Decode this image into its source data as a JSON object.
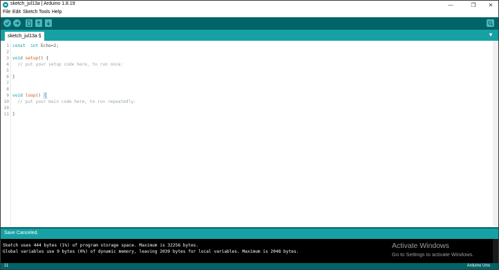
{
  "window": {
    "title": "sketch_jul13a | Arduino 1.8.19",
    "minimize": "—",
    "maximize": "❐",
    "close": "✕"
  },
  "menu": [
    "File",
    "Edit",
    "Sketch",
    "Tools",
    "Help"
  ],
  "toolbar": {
    "verify_icon": "check-icon",
    "upload_icon": "arrow-right-icon",
    "new_icon": "new-file-icon",
    "open_icon": "arrow-up-icon",
    "save_icon": "arrow-down-icon",
    "serial_icon": "magnifier-icon",
    "accent": "#006468"
  },
  "tabs": [
    {
      "label": "sketch_jul13a §"
    }
  ],
  "editor": {
    "lines": [
      {
        "n": "1",
        "parts": [
          [
            "kw",
            "const"
          ],
          [
            "",
            "  "
          ],
          [
            "kw",
            "int"
          ],
          [
            "",
            " Echo=2;"
          ]
        ]
      },
      {
        "n": "2",
        "parts": []
      },
      {
        "n": "3",
        "parts": [
          [
            "kw",
            "void"
          ],
          [
            "",
            " "
          ],
          [
            "fn",
            "setup"
          ],
          [
            "",
            "() {"
          ]
        ]
      },
      {
        "n": "4",
        "parts": [
          [
            "cm",
            "  // put your setup code here, to run once:"
          ]
        ]
      },
      {
        "n": "5",
        "parts": []
      },
      {
        "n": "6",
        "parts": [
          [
            "",
            "}"
          ]
        ]
      },
      {
        "n": "7",
        "parts": []
      },
      {
        "n": "8",
        "parts": []
      },
      {
        "n": "9",
        "parts": [
          [
            "kw",
            "void"
          ],
          [
            "",
            " "
          ],
          [
            "fn",
            "loop"
          ],
          [
            "",
            "() "
          ],
          [
            "brace",
            "{"
          ]
        ]
      },
      {
        "n": "10",
        "parts": [
          [
            "cm",
            "  // put your main code here, to run repeatedly:"
          ]
        ]
      },
      {
        "n": "10",
        "parts": []
      },
      {
        "n": "11",
        "parts": [
          [
            "",
            "}"
          ]
        ]
      }
    ]
  },
  "status": {
    "message": "Save Canceled."
  },
  "console": {
    "line1": "Sketch uses 444 bytes (1%) of program storage space. Maximum is 32256 bytes.",
    "line2": "Global variables use 9 bytes (0%) of dynamic memory, leaving 2039 bytes for local variables. Maximum is 2048 bytes.",
    "watermark_title": "Activate Windows",
    "watermark_sub": "Go to Settings to activate Windows."
  },
  "footer": {
    "line": "11",
    "board": "Arduino Uno"
  }
}
